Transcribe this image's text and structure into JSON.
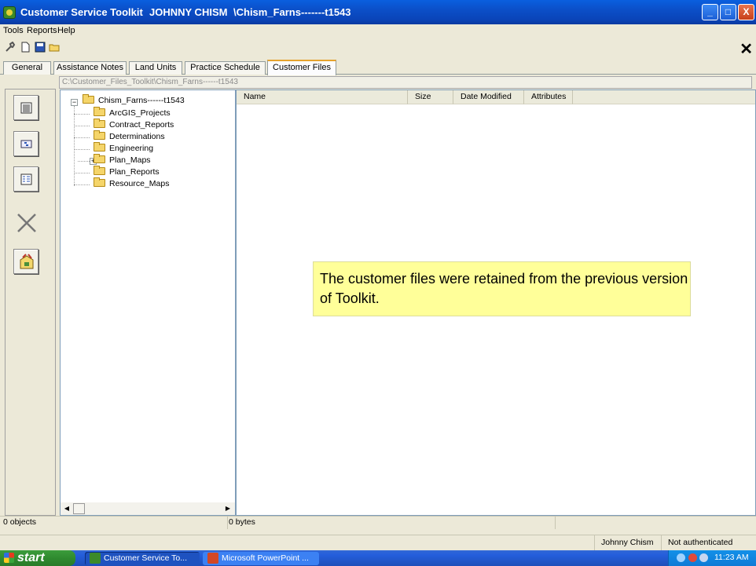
{
  "window": {
    "title_app": "Customer Service Toolkit",
    "title_user": "JOHNNY CHISM",
    "title_path": "\\Chism_Farns-------t1543",
    "minimize": "_",
    "maximize": "□",
    "close": "X"
  },
  "menu": [
    "Tools",
    "Reports",
    "Help"
  ],
  "toolbar": {
    "icons": [
      "wrench-icon",
      "new-document-icon",
      "save-icon",
      "open-folder-icon"
    ],
    "close": "✕"
  },
  "tabs": [
    {
      "label": "General"
    },
    {
      "label": "Assistance Notes"
    },
    {
      "label": "Land Units"
    },
    {
      "label": "Practice Schedule"
    },
    {
      "label": "Customer Files",
      "active": true
    }
  ],
  "path": "C:\\Customer_Files_Toolkit\\Chism_Farns------t1543",
  "side_buttons": [
    "details-view-icon",
    "list-view-icon",
    "tree-view-icon",
    "delete-icon",
    "tools-icon"
  ],
  "tree": {
    "root": "Chism_Farns------t1543",
    "children": [
      {
        "label": "ArcGIS_Projects"
      },
      {
        "label": "Contract_Reports"
      },
      {
        "label": "Determinations"
      },
      {
        "label": "Engineering"
      },
      {
        "label": "Plan_Maps",
        "expandable": true
      },
      {
        "label": "Plan_Reports"
      },
      {
        "label": "Resource_Maps"
      }
    ]
  },
  "file_list": {
    "columns": [
      "Name",
      "Size",
      "Date Modified",
      "Attributes"
    ]
  },
  "callout": "The customer files were retained from the previous version of Toolkit.",
  "status": {
    "objects": "0 objects",
    "bytes": "0 bytes"
  },
  "user_status": {
    "user": "Johnny Chism",
    "auth": "Not authenticated"
  },
  "taskbar": {
    "start": "start",
    "items": [
      "Customer Service To...",
      "Microsoft PowerPoint ..."
    ],
    "clock": "11:23 AM"
  }
}
